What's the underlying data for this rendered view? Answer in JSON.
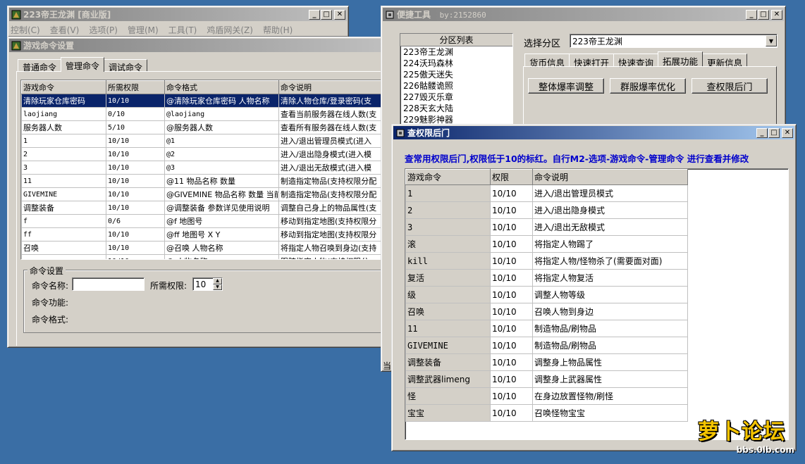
{
  "main_window": {
    "title": "223帝王龙渊 [商业版]",
    "menu": [
      "控制(C)",
      "查看(V)",
      "选项(P)",
      "管理(M)",
      "工具(T)",
      "鸡盾网关(Z)",
      "帮助(H)"
    ]
  },
  "cmd_window": {
    "title": "游戏命令设置",
    "tabs": [
      "普通命令",
      "管理命令",
      "调试命令"
    ],
    "columns": [
      "游戏命令",
      "所需权限",
      "命令格式",
      "命令说明"
    ],
    "rows": [
      [
        "清除玩家仓库密码",
        "10/10",
        "@清除玩家仓库密码 人物名称",
        "清除人物仓库/登录密码(支"
      ],
      [
        "laojiang",
        "0/10",
        "@laojiang",
        "查看当前服务器在线人数(支"
      ],
      [
        "服务器人数",
        "5/10",
        "@服务器人数",
        "查看所有服务器在线人数(支"
      ],
      [
        "1",
        "10/10",
        "@1",
        "进入/退出管理员模式(进入"
      ],
      [
        "2",
        "10/10",
        "@2",
        "进入/退出隐身模式(进入模"
      ],
      [
        "3",
        "10/10",
        "@3",
        "进入/退出无敌模式(进入模"
      ],
      [
        "11",
        "10/10",
        "@11 物品名称 数量",
        "制造指定物品(支持权限分配"
      ],
      [
        "GIVEMINE",
        "10/10",
        "@GIVEMINE 物品名称 数量 当前",
        "制造指定物品(支持权限分配"
      ],
      [
        "调整装备",
        "10/10",
        "@调整装备 参数详见使用说明",
        "调整自己身上的物品属性(支"
      ],
      [
        "f",
        "0/6",
        "@f 地图号",
        "移动到指定地图(支持权限分"
      ],
      [
        "ff",
        "10/10",
        "@ff 地图号 X Y",
        "移动到指定地图(支持权限分"
      ],
      [
        "召唤",
        "10/10",
        "@召唤 人物名称",
        "将指定人物召唤到身边(支持"
      ],
      [
        "",
        "10/10",
        "@ 人物名称",
        "跟踪指定人物(支持权限分"
      ]
    ],
    "group_title": "命令设置",
    "name_label": "命令名称:",
    "perm_label": "所需权限:",
    "perm_value": "10",
    "func_label": "命令功能:",
    "format_label": "命令格式:"
  },
  "tools_window": {
    "title": "便捷工具",
    "author": "by:2152860",
    "list_header": "分区列表",
    "zones": [
      "223帝王龙渊",
      "224沃玛森林",
      "225傲天迷失",
      "226骷髅诡照",
      "227毁灭乐章",
      "228天玄大陆",
      "229魅影神器"
    ],
    "select_label": "选择分区",
    "select_value": "223帝王龙渊",
    "tabs": [
      "货币信息",
      "快速打开",
      "快速查询",
      "拓展功能",
      "更新信息"
    ],
    "buttons": [
      "整体爆率调整",
      "群服爆率优化",
      "查权限后门"
    ],
    "partial_char": "当"
  },
  "backdoor_window": {
    "title": "查权限后门",
    "notice": "查常用权限后门,权限低于10的标红。自行M2-选项-游戏命令-管理命令 进行查看并修改",
    "columns": [
      "游戏命令",
      "权限",
      "命令说明"
    ],
    "rows": [
      [
        "1",
        "10/10",
        "进入/退出管理员模式"
      ],
      [
        "2",
        "10/10",
        "进入/退出隐身模式"
      ],
      [
        "3",
        "10/10",
        "进入/退出无敌模式"
      ],
      [
        "滚",
        "10/10",
        "将指定人物踢了"
      ],
      [
        "kill",
        "10/10",
        "将指定人物/怪物杀了(需要面对面)"
      ],
      [
        "复活",
        "10/10",
        "将指定人物复活"
      ],
      [
        "级",
        "10/10",
        "调整人物等级"
      ],
      [
        "召唤",
        "10/10",
        "召唤人物到身边"
      ],
      [
        "11",
        "10/10",
        "制造物品/刷物品"
      ],
      [
        "GIVEMINE",
        "10/10",
        "制造物品/刷物品"
      ],
      [
        "调整装备",
        "10/10",
        "调整身上物品属性"
      ],
      [
        "调整武器limeng",
        "10/10",
        "调整身上武器属性"
      ],
      [
        "怪",
        "10/10",
        "在身边放置怪物/刷怪"
      ],
      [
        "宝宝",
        "10/10",
        "召唤怪物宝宝"
      ]
    ]
  },
  "watermark": {
    "logo": "萝卜论坛",
    "url": "bbs.0lb.com"
  },
  "colors": {
    "desktop": "#3a6ea5",
    "title_active": "#0a246a",
    "notice_text": "#0000cc",
    "selection": "#0a246a"
  }
}
